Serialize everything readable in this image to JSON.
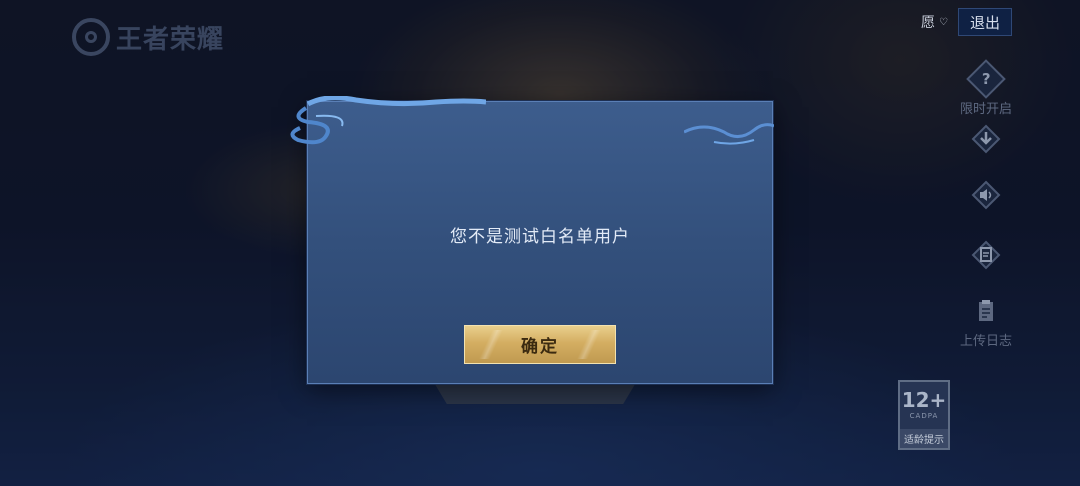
{
  "header": {
    "logo_text": "王者荣耀",
    "wish_label": "愿",
    "exit_label": "退出"
  },
  "side_menu": {
    "items": [
      {
        "icon": "question-icon",
        "glyph": "?",
        "label": "限时开启"
      },
      {
        "icon": "download-icon",
        "glyph": "",
        "label": ""
      },
      {
        "icon": "speaker-icon",
        "glyph": "",
        "label": ""
      },
      {
        "icon": "document-icon",
        "glyph": "",
        "label": ""
      },
      {
        "icon": "clipboard-icon",
        "glyph": "",
        "label": "上传日志"
      }
    ]
  },
  "dialog": {
    "message": "您不是测试白名单用户",
    "confirm_label": "确定"
  },
  "age_rating": {
    "number": "12+",
    "org": "CADPA",
    "caption": "适龄提示"
  },
  "colors": {
    "dialog_bg": "#33507c",
    "dialog_border": "#5a7fb6",
    "confirm_gold": "#d4ae62",
    "exit_bg": "#0f2144"
  }
}
